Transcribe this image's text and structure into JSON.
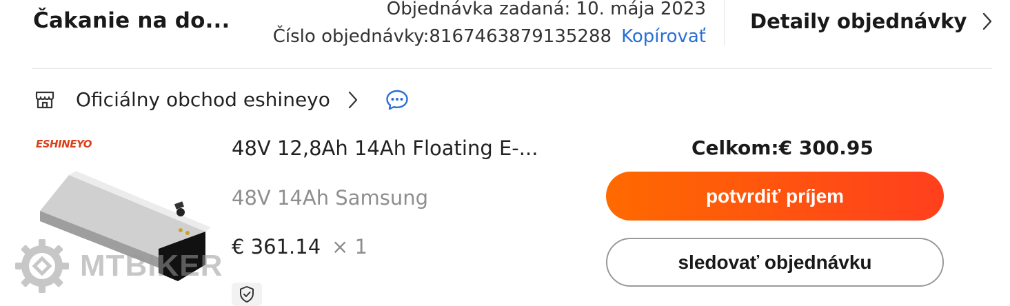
{
  "header": {
    "status": "Čakanie na do...",
    "order_date": "Objednávka zadaná: 10. mája 2023",
    "order_number": "Číslo objednávky:8167463879135288",
    "copy_label": "Kopírovať",
    "details_label": "Detaily objednávky"
  },
  "store": {
    "name": "Oficiálny obchod eshineyo"
  },
  "product": {
    "brand_logo": "ESHINEYO",
    "title": "48V 12,8Ah 14Ah Floating E-...",
    "variant": "48V 14Ah Samsung",
    "price": "€ 361.14",
    "quantity": "× 1"
  },
  "summary": {
    "total": "Celkom:€ 300.95",
    "confirm_label": "potvrdiť príjem",
    "track_label": "sledovať objednávku"
  },
  "watermark": {
    "text": "MTBIKER"
  },
  "colors": {
    "accent_orange": "#ff5a12",
    "link_blue": "#2a6fd6"
  }
}
